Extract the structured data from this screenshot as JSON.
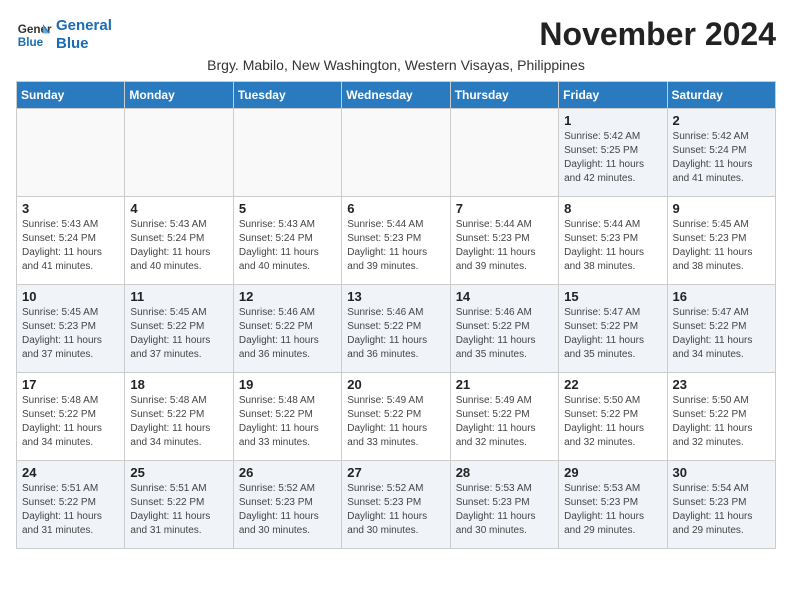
{
  "logo": {
    "line1": "General",
    "line2": "Blue"
  },
  "title": "November 2024",
  "subtitle": "Brgy. Mabilo, New Washington, Western Visayas, Philippines",
  "days_header": [
    "Sunday",
    "Monday",
    "Tuesday",
    "Wednesday",
    "Thursday",
    "Friday",
    "Saturday"
  ],
  "weeks": [
    [
      {
        "day": "",
        "info": ""
      },
      {
        "day": "",
        "info": ""
      },
      {
        "day": "",
        "info": ""
      },
      {
        "day": "",
        "info": ""
      },
      {
        "day": "",
        "info": ""
      },
      {
        "day": "1",
        "info": "Sunrise: 5:42 AM\nSunset: 5:25 PM\nDaylight: 11 hours and 42 minutes."
      },
      {
        "day": "2",
        "info": "Sunrise: 5:42 AM\nSunset: 5:24 PM\nDaylight: 11 hours and 41 minutes."
      }
    ],
    [
      {
        "day": "3",
        "info": "Sunrise: 5:43 AM\nSunset: 5:24 PM\nDaylight: 11 hours and 41 minutes."
      },
      {
        "day": "4",
        "info": "Sunrise: 5:43 AM\nSunset: 5:24 PM\nDaylight: 11 hours and 40 minutes."
      },
      {
        "day": "5",
        "info": "Sunrise: 5:43 AM\nSunset: 5:24 PM\nDaylight: 11 hours and 40 minutes."
      },
      {
        "day": "6",
        "info": "Sunrise: 5:44 AM\nSunset: 5:23 PM\nDaylight: 11 hours and 39 minutes."
      },
      {
        "day": "7",
        "info": "Sunrise: 5:44 AM\nSunset: 5:23 PM\nDaylight: 11 hours and 39 minutes."
      },
      {
        "day": "8",
        "info": "Sunrise: 5:44 AM\nSunset: 5:23 PM\nDaylight: 11 hours and 38 minutes."
      },
      {
        "day": "9",
        "info": "Sunrise: 5:45 AM\nSunset: 5:23 PM\nDaylight: 11 hours and 38 minutes."
      }
    ],
    [
      {
        "day": "10",
        "info": "Sunrise: 5:45 AM\nSunset: 5:23 PM\nDaylight: 11 hours and 37 minutes."
      },
      {
        "day": "11",
        "info": "Sunrise: 5:45 AM\nSunset: 5:22 PM\nDaylight: 11 hours and 37 minutes."
      },
      {
        "day": "12",
        "info": "Sunrise: 5:46 AM\nSunset: 5:22 PM\nDaylight: 11 hours and 36 minutes."
      },
      {
        "day": "13",
        "info": "Sunrise: 5:46 AM\nSunset: 5:22 PM\nDaylight: 11 hours and 36 minutes."
      },
      {
        "day": "14",
        "info": "Sunrise: 5:46 AM\nSunset: 5:22 PM\nDaylight: 11 hours and 35 minutes."
      },
      {
        "day": "15",
        "info": "Sunrise: 5:47 AM\nSunset: 5:22 PM\nDaylight: 11 hours and 35 minutes."
      },
      {
        "day": "16",
        "info": "Sunrise: 5:47 AM\nSunset: 5:22 PM\nDaylight: 11 hours and 34 minutes."
      }
    ],
    [
      {
        "day": "17",
        "info": "Sunrise: 5:48 AM\nSunset: 5:22 PM\nDaylight: 11 hours and 34 minutes."
      },
      {
        "day": "18",
        "info": "Sunrise: 5:48 AM\nSunset: 5:22 PM\nDaylight: 11 hours and 34 minutes."
      },
      {
        "day": "19",
        "info": "Sunrise: 5:48 AM\nSunset: 5:22 PM\nDaylight: 11 hours and 33 minutes."
      },
      {
        "day": "20",
        "info": "Sunrise: 5:49 AM\nSunset: 5:22 PM\nDaylight: 11 hours and 33 minutes."
      },
      {
        "day": "21",
        "info": "Sunrise: 5:49 AM\nSunset: 5:22 PM\nDaylight: 11 hours and 32 minutes."
      },
      {
        "day": "22",
        "info": "Sunrise: 5:50 AM\nSunset: 5:22 PM\nDaylight: 11 hours and 32 minutes."
      },
      {
        "day": "23",
        "info": "Sunrise: 5:50 AM\nSunset: 5:22 PM\nDaylight: 11 hours and 32 minutes."
      }
    ],
    [
      {
        "day": "24",
        "info": "Sunrise: 5:51 AM\nSunset: 5:22 PM\nDaylight: 11 hours and 31 minutes."
      },
      {
        "day": "25",
        "info": "Sunrise: 5:51 AM\nSunset: 5:22 PM\nDaylight: 11 hours and 31 minutes."
      },
      {
        "day": "26",
        "info": "Sunrise: 5:52 AM\nSunset: 5:23 PM\nDaylight: 11 hours and 30 minutes."
      },
      {
        "day": "27",
        "info": "Sunrise: 5:52 AM\nSunset: 5:23 PM\nDaylight: 11 hours and 30 minutes."
      },
      {
        "day": "28",
        "info": "Sunrise: 5:53 AM\nSunset: 5:23 PM\nDaylight: 11 hours and 30 minutes."
      },
      {
        "day": "29",
        "info": "Sunrise: 5:53 AM\nSunset: 5:23 PM\nDaylight: 11 hours and 29 minutes."
      },
      {
        "day": "30",
        "info": "Sunrise: 5:54 AM\nSunset: 5:23 PM\nDaylight: 11 hours and 29 minutes."
      }
    ]
  ]
}
